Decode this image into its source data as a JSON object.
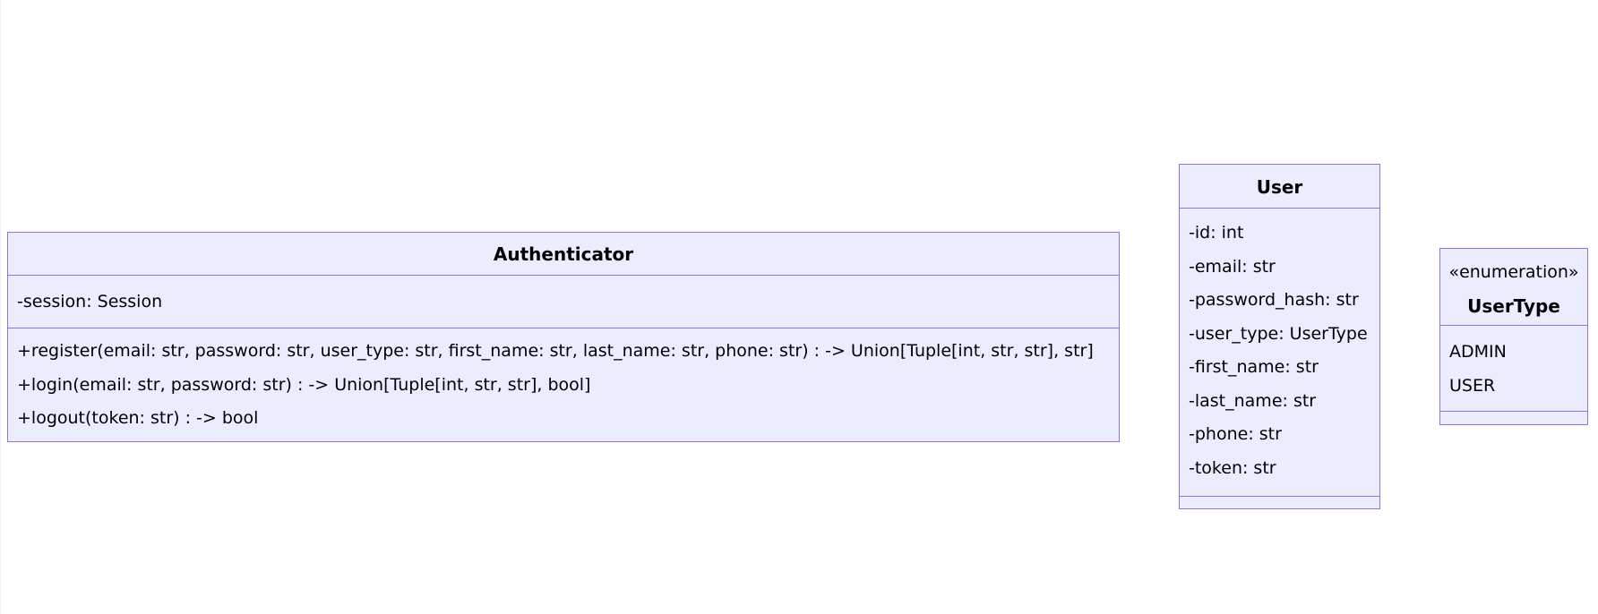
{
  "classes": {
    "authenticator": {
      "name": "Authenticator",
      "attributes": [
        "-session: Session"
      ],
      "methods": [
        "+register(email: str, password: str, user_type: str, first_name: str, last_name: str, phone: str) : -> Union[Tuple[int, str, str], str]",
        "+login(email: str, password: str) : -> Union[Tuple[int, str, str], bool]",
        "+logout(token: str) : -> bool"
      ]
    },
    "user": {
      "name": "User",
      "attributes": [
        "-id: int",
        "-email: str",
        "-password_hash: str",
        "-user_type: UserType",
        "-first_name: str",
        "-last_name: str",
        "-phone: str",
        "-token: str"
      ],
      "methods": []
    },
    "usertype": {
      "stereotype": "«enumeration»",
      "name": "UserType",
      "attributes": [
        "ADMIN",
        "USER"
      ],
      "methods": []
    }
  },
  "colors": {
    "fill": "#ECECFF",
    "stroke": "#9370DB",
    "text": "#000000"
  }
}
